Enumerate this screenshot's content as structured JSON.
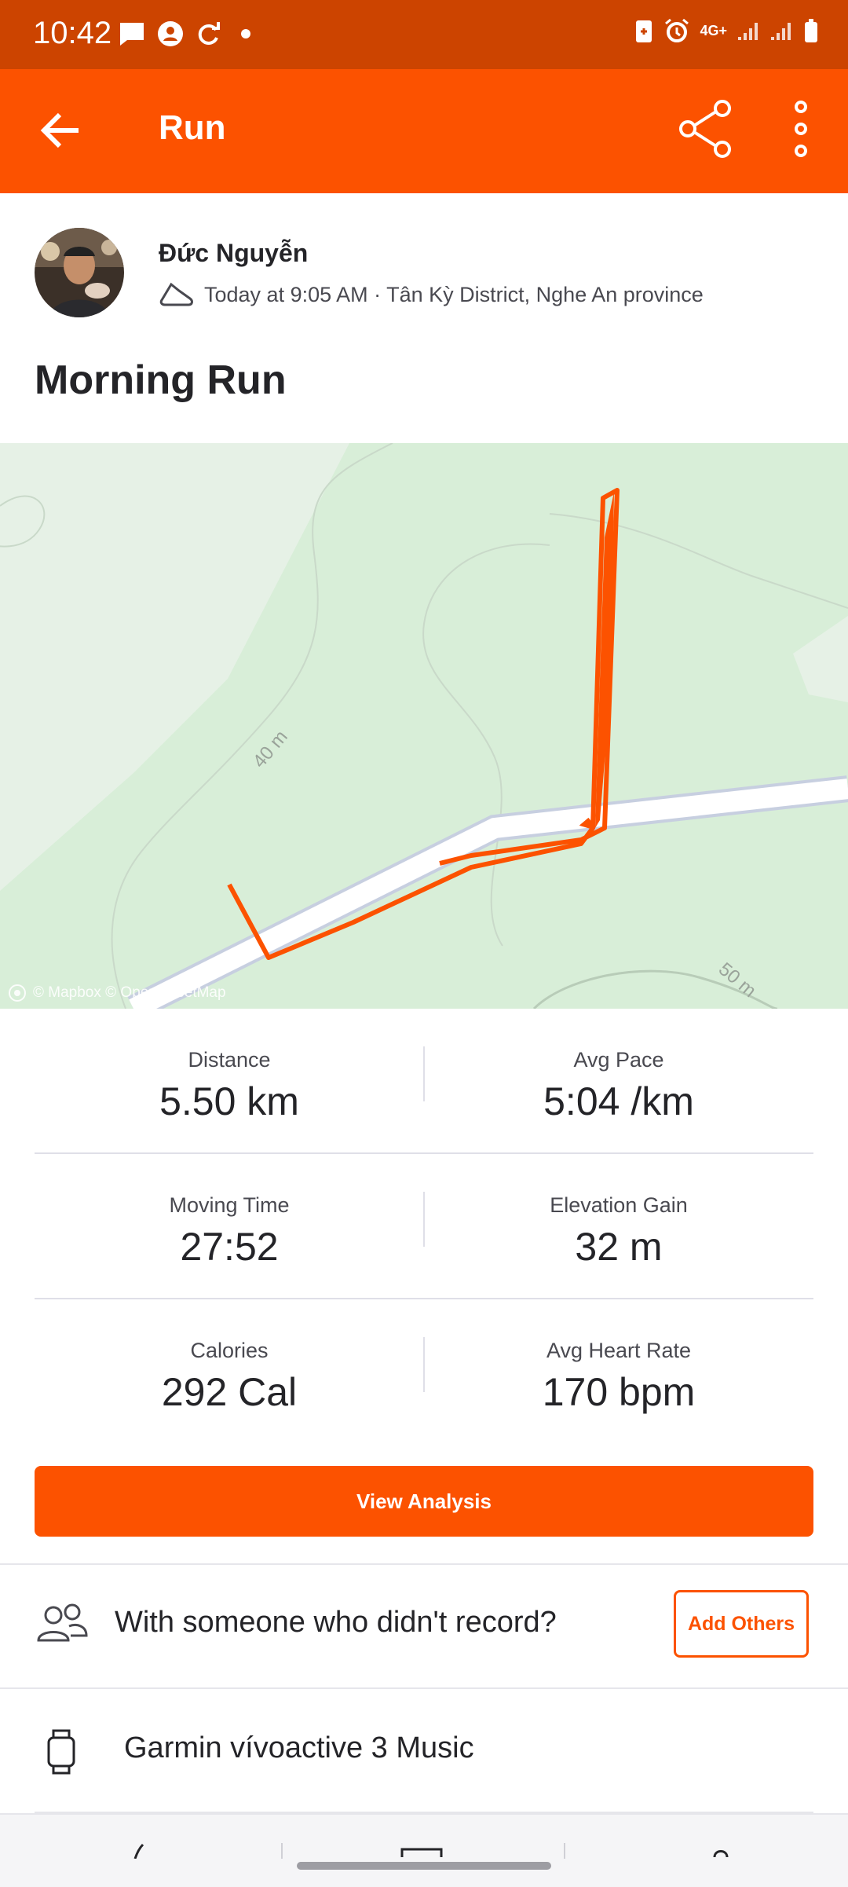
{
  "status_bar": {
    "time": "10:42",
    "left_icons": [
      "message-icon",
      "account-icon",
      "sync-icon",
      "dot-icon"
    ],
    "right_icons": [
      "battery-saver-icon",
      "alarm-icon",
      "network-4g-icon",
      "signal-icon",
      "signal-icon",
      "battery-icon"
    ],
    "network_label": "4G+"
  },
  "app_bar": {
    "title": "Run",
    "back_icon": "arrow-left-icon",
    "share_icon": "share-icon",
    "more_icon": "more-vertical-icon"
  },
  "activity": {
    "athlete_name": "Đức Nguyễn",
    "meta": "Today at 9:05 AM · Tân Kỳ District, Nghe An province",
    "sport_icon": "shoe-icon",
    "title": "Morning Run"
  },
  "map": {
    "labels": [
      "40 m",
      "50 m"
    ],
    "attribution": "© Mapbox © OpenStreetMap",
    "route_color": "#fc5200",
    "land_color": "#d8eed8",
    "road_color": "#ffffff"
  },
  "stats": [
    {
      "label": "Distance",
      "value": "5.50 km"
    },
    {
      "label": "Avg Pace",
      "value": "5:04 /km"
    },
    {
      "label": "Moving Time",
      "value": "27:52"
    },
    {
      "label": "Elevation Gain",
      "value": "32 m"
    },
    {
      "label": "Calories",
      "value": "292 Cal"
    },
    {
      "label": "Avg Heart Rate",
      "value": "170 bpm"
    }
  ],
  "actions": {
    "view_analysis": "View Analysis",
    "with_someone": "With someone who didn't record?",
    "add_others": "Add Others",
    "device": "Garmin vívoactive 3 Music"
  },
  "colors": {
    "brand": "#fc5200",
    "status_bar": "#cc4400"
  }
}
